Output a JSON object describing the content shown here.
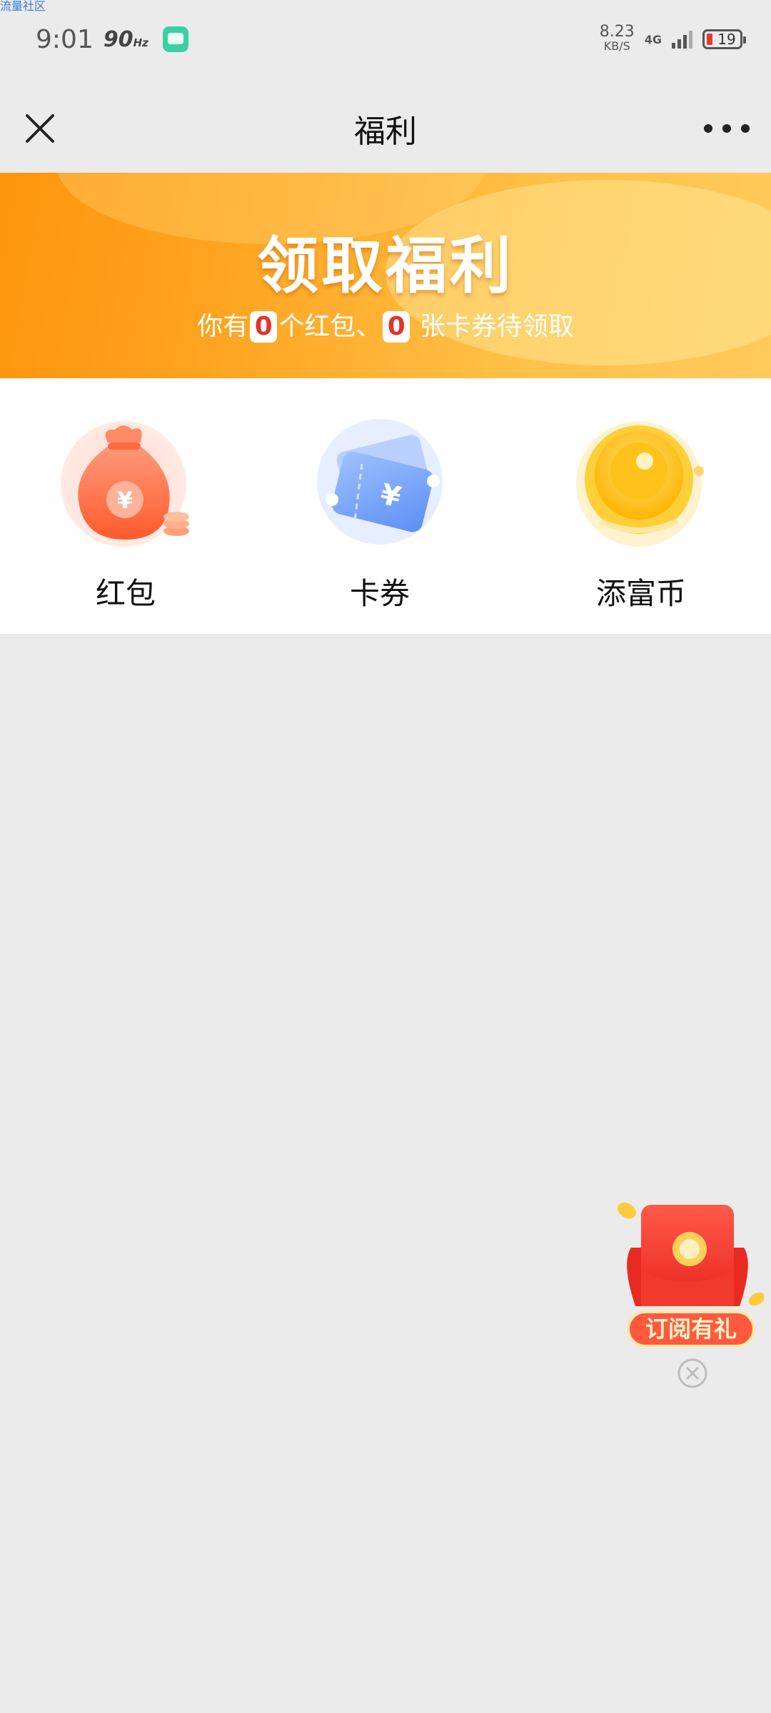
{
  "watermark": "流量社区",
  "status_bar": {
    "time": "9:01",
    "refresh_rate": "90",
    "refresh_unit": "Hz",
    "net_speed": "8.23",
    "net_unit": "KB/S",
    "network": "4G",
    "battery": "19"
  },
  "nav": {
    "title": "福利"
  },
  "banner": {
    "title": "领取福利",
    "sub_prefix": "你有",
    "redpacket_count": "0",
    "sub_middle": "个红包、",
    "coupon_count": "0",
    "sub_suffix": " 张卡券待领取"
  },
  "categories": [
    {
      "label": "红包",
      "icon": "money-bag-icon"
    },
    {
      "label": "卡券",
      "icon": "coupon-ticket-icon"
    },
    {
      "label": "添富币",
      "icon": "gold-coin-icon"
    }
  ],
  "promo": {
    "label": "订阅有礼"
  },
  "colors": {
    "banner_start": "#ff8a00",
    "banner_end": "#ffd068",
    "accent_red": "#e0362b",
    "page_bg": "#ebebeb"
  }
}
